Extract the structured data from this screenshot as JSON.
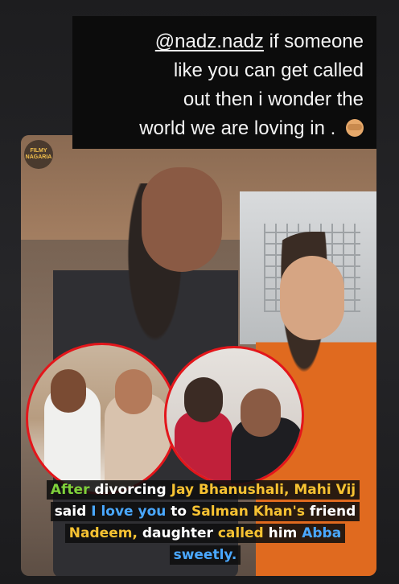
{
  "story_text": {
    "mention": "@nadz.nadz",
    "line1_rest": "if someone",
    "line2": "like you can get called",
    "line3": "out then i wonder the",
    "line4": "world we are loving in .",
    "emoji": "see-no-evil-monkey-icon"
  },
  "photo": {
    "logo_text": "FILMY NAGARIA"
  },
  "caption": {
    "w1": "After",
    "w2": "divorcing",
    "w3": "Jay Bhanushali,",
    "w4": "Mahi",
    "w5": "Vij",
    "w6": "said",
    "w7": "I love you",
    "w8": "to",
    "w9": "Salman Khan's",
    "w10": "friend",
    "w11": "Nadeem,",
    "w12": "daughter",
    "w13": "called",
    "w14": "him",
    "w15": "Abba sweetly."
  },
  "colors": {
    "green": "#7fd13b",
    "yellow": "#f6c232",
    "blue": "#4aa8ff",
    "circle_border": "#e3161b"
  }
}
